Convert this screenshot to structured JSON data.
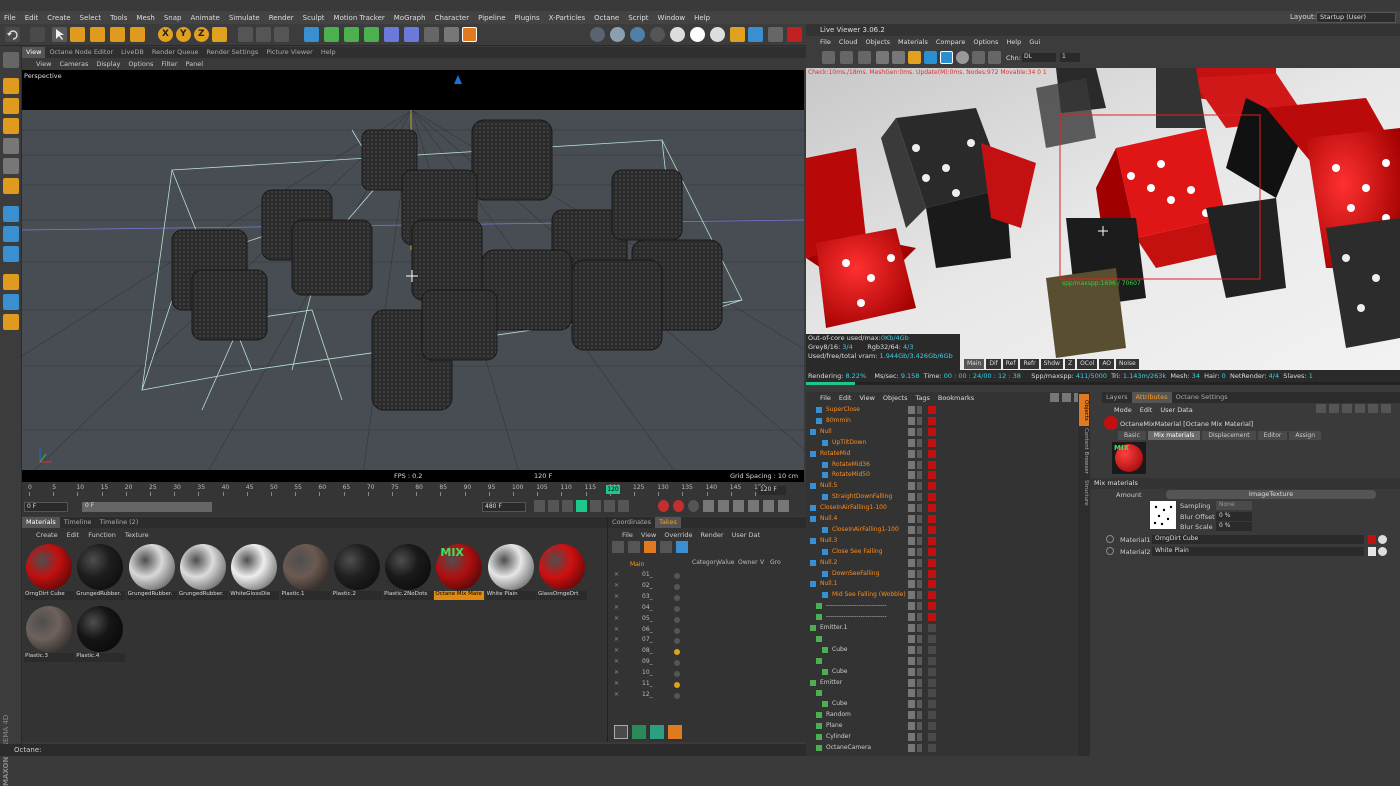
{
  "menubar": [
    "File",
    "Edit",
    "Create",
    "Select",
    "Tools",
    "Mesh",
    "Snap",
    "Animate",
    "Simulate",
    "Render",
    "Sculpt",
    "Motion Tracker",
    "MoGraph",
    "Character",
    "Pipeline",
    "Plugins",
    "X-Particles",
    "Octane",
    "Script",
    "Window",
    "Help"
  ],
  "layout": {
    "label": "Layout:",
    "value": "Startup (User)"
  },
  "viewport_tabs": [
    "View",
    "Octane Node Editor",
    "LiveDB",
    "Render Queue",
    "Render Settings",
    "Picture Viewer",
    "Help"
  ],
  "viewport_menu": [
    "View",
    "Cameras",
    "Display",
    "Options",
    "Filter",
    "Panel"
  ],
  "viewport": {
    "label": "Perspective",
    "fps": "FPS : 0.2",
    "frame": "120 F",
    "grid": "Grid Spacing : 10 cm"
  },
  "timeline": {
    "ticks": [
      "0",
      "5",
      "10",
      "15",
      "20",
      "25",
      "30",
      "35",
      "40",
      "45",
      "50",
      "55",
      "60",
      "65",
      "70",
      "75",
      "80",
      "85",
      "90",
      "95",
      "100",
      "105",
      "110",
      "115",
      "120",
      "125",
      "130",
      "135",
      "140",
      "145",
      "150"
    ],
    "current": "120",
    "end_label": "120 F",
    "start_field": "0 F",
    "min_field": "0 F",
    "max_field": "480 F"
  },
  "material_tabs": [
    "Materials",
    "Timeline",
    "Timeline (2)"
  ],
  "material_menu": [
    "Create",
    "Edit",
    "Function",
    "Texture"
  ],
  "materials": [
    {
      "name": "OrngDirt Cube",
      "color": "#c21010"
    },
    {
      "name": "GrungedRubber.",
      "color": "#1e1e1e"
    },
    {
      "name": "GrungedRubber.",
      "color": "#d8d8d8"
    },
    {
      "name": "GrungedRubber.",
      "color": "#dcdcdc"
    },
    {
      "name": "WhiteGlossDie",
      "color": "#eeeeee"
    },
    {
      "name": "Plastic.1",
      "color": "#6b5a52"
    },
    {
      "name": "Plastic.2",
      "color": "#202020"
    },
    {
      "name": "Plastic.2NoDots",
      "color": "#1a1a1a"
    },
    {
      "name": "Octane Mix Mate",
      "color": "#b01010"
    },
    {
      "name": "White Plain",
      "color": "#e6e6e6"
    },
    {
      "name": "GlassOrngeDrt",
      "color": "#d01010"
    },
    {
      "name": "Plastic.3",
      "color": "#6e625c"
    },
    {
      "name": "Plastic.4",
      "color": "#151515"
    }
  ],
  "mix_label": "MIX",
  "takes": {
    "tabs": [
      "Coordinates",
      "Takes"
    ],
    "menu": [
      "File",
      "View",
      "Override",
      "Render",
      "User Dat"
    ],
    "columns": [
      "Category",
      "Value",
      "Owner",
      "V",
      "Gro"
    ],
    "main": "Main",
    "items": [
      "01_",
      "02_",
      "03_",
      "04_",
      "05_",
      "06_",
      "07_",
      "08_",
      "09_",
      "10_",
      "11_",
      "12_"
    ]
  },
  "live_viewer": {
    "title": "Live Viewer 3.06.2",
    "menu": [
      "File",
      "Cloud",
      "Objects",
      "Materials",
      "Compare",
      "Options",
      "Help",
      "Gui"
    ],
    "chn_label": "Chn:",
    "chn_value": "DL",
    "chn_num": "1",
    "check_text": "Check:10ms./18ms. MeshGen:0ms. Update(M):0ms. Nodes:972 Movable:34  0 1",
    "spp_text": "spp/maxspp:1696 / 70607",
    "ooc": {
      "l1": "Out-of-core used/max:",
      "v1": "0Kb/4Gb",
      "l2": "Grey8/16:",
      "v2": "3/4",
      "l3": "Rgb32/64:",
      "v3": "4/3",
      "l4": "Used/free/total vram:",
      "v4": "1.944Gb/3.426Gb/6Gb"
    },
    "passes": [
      "Main",
      "Dif",
      "Ref",
      "Refr",
      "Shdw",
      "Z",
      "OCol",
      "AO",
      "Noise"
    ],
    "stats": {
      "rendering_l": "Rendering:",
      "rendering_v": "8.22%",
      "ms_l": "Ms/sec:",
      "ms_v": "9.158",
      "time_l": "Time:",
      "time_v": "00 : 00 : 24/00 : 12 : 38",
      "spp_l": "Spp/maxspp:",
      "spp_v": "411/5000",
      "tri_l": "Tri:",
      "tri_v": "1.143m/263k",
      "mesh_l": "Mesh:",
      "mesh_v": "34",
      "hair_l": "Hair:",
      "hair_v": "0",
      "net_l": "NetRender:",
      "net_v": "4/4",
      "slaves_l": "Slaves:",
      "slaves_v": "1"
    }
  },
  "object_manager": {
    "menu": [
      "File",
      "Edit",
      "View",
      "Objects",
      "Tags",
      "Bookmarks"
    ],
    "rows": [
      {
        "name": "SuperClose",
        "color": "#ff8c1a",
        "indent": 1
      },
      {
        "name": "80mmin",
        "color": "#ff8c1a",
        "indent": 1
      },
      {
        "name": "Null",
        "color": "#ff8c1a",
        "indent": 0
      },
      {
        "name": "UpTiltDown",
        "color": "#ff8c1a",
        "indent": 2
      },
      {
        "name": "RotateMid",
        "color": "#ff8c1a",
        "indent": 0
      },
      {
        "name": "RotateMid36",
        "color": "#ff8c1a",
        "indent": 2
      },
      {
        "name": "RotateMid50",
        "color": "#ff8c1a",
        "indent": 2
      },
      {
        "name": "Null.5",
        "color": "#ff8c1a",
        "indent": 0
      },
      {
        "name": "StraightDownFalling",
        "color": "#ff8c1a",
        "indent": 2
      },
      {
        "name": "CloseInAirFalling1-100",
        "color": "#ff8c1a",
        "indent": 0
      },
      {
        "name": "Null.4",
        "color": "#ff8c1a",
        "indent": 0
      },
      {
        "name": "CloseInAirFalling1-100",
        "color": "#ff8c1a",
        "indent": 2
      },
      {
        "name": "Null.3",
        "color": "#ff8c1a",
        "indent": 0
      },
      {
        "name": "Close See Falling",
        "color": "#ff8c1a",
        "indent": 2
      },
      {
        "name": "Null.2",
        "color": "#ff8c1a",
        "indent": 0
      },
      {
        "name": "DownSeeFalling",
        "color": "#ff8c1a",
        "indent": 2
      },
      {
        "name": "Null.1",
        "color": "#ff8c1a",
        "indent": 0
      },
      {
        "name": "Mid See Falling (Wobble)",
        "color": "#ff8c1a",
        "indent": 2
      },
      {
        "name": "----------------------------",
        "color": "#cccccc",
        "indent": 1
      },
      {
        "name": "----------------------------",
        "color": "#cccccc",
        "indent": 1
      },
      {
        "name": "Emitter.1",
        "color": "#cccccc",
        "indent": 0
      },
      {
        "name": "",
        "color": "#cccccc",
        "indent": 1
      },
      {
        "name": "Cube",
        "color": "#cccccc",
        "indent": 2
      },
      {
        "name": "",
        "color": "#cccccc",
        "indent": 1
      },
      {
        "name": "Cube",
        "color": "#cccccc",
        "indent": 2
      },
      {
        "name": "Emitter",
        "color": "#cccccc",
        "indent": 0
      },
      {
        "name": "",
        "color": "#cccccc",
        "indent": 1
      },
      {
        "name": "Cube",
        "color": "#cccccc",
        "indent": 2
      },
      {
        "name": "Random",
        "color": "#cccccc",
        "indent": 1
      },
      {
        "name": "Plane",
        "color": "#cccccc",
        "indent": 1
      },
      {
        "name": "Cylinder",
        "color": "#cccccc",
        "indent": 1
      },
      {
        "name": "OctaneCamera",
        "color": "#cccccc",
        "indent": 1
      }
    ],
    "side_tabs": [
      "Objects",
      "Content Browser",
      "Structure"
    ]
  },
  "attributes": {
    "tabs": [
      "Layers",
      "Attributes",
      "Octane Settings"
    ],
    "menu": [
      "Mode",
      "Edit",
      "User Data"
    ],
    "title": "OctaneMixMaterial [Octane Mix Material]",
    "subtabs": [
      "Basic",
      "Mix materials",
      "Displacement",
      "Editor",
      "Assign"
    ],
    "section": "Mix materials",
    "amount_label": "Amount",
    "amount_value": "ImageTexture",
    "sampling_label": "Sampling",
    "sampling_value": "None",
    "blur_offset_label": "Blur Offset",
    "blur_offset_value": "0 %",
    "blur_scale_label": "Blur Scale",
    "blur_scale_value": "0 %",
    "material1_label": "Material1",
    "material1_value": "OrngDirt Cube",
    "material2_label": "Material2",
    "material2_value": "White Plain"
  },
  "status": "Octane:",
  "brand1": "MAXON",
  "brand2": "CINEMA 4D"
}
